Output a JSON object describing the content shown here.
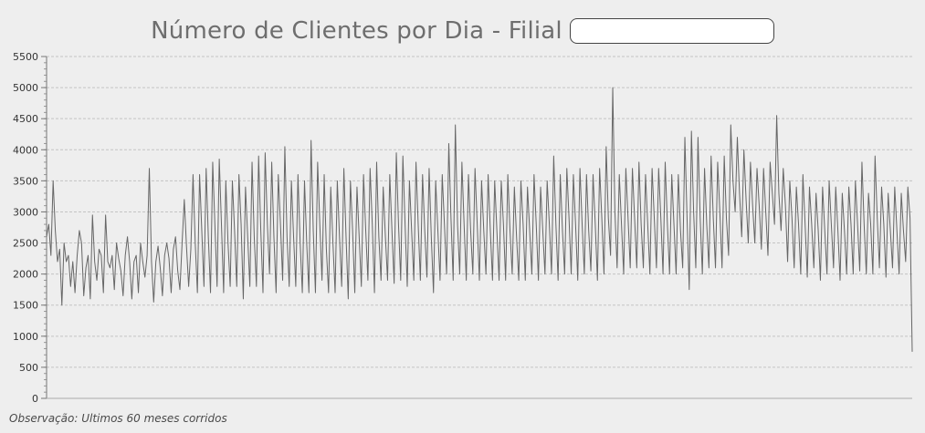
{
  "chart_data": {
    "type": "line",
    "title": "Número de Clientes por Dia - Filial",
    "filial_value": "",
    "xlabel": "",
    "ylabel": "",
    "ylim": [
      0,
      5500
    ],
    "yticks": [
      0,
      500,
      1000,
      1500,
      2000,
      2500,
      3000,
      3500,
      4000,
      4500,
      5000,
      5500
    ],
    "grid": true,
    "series": [
      {
        "line_color": "#666666",
        "values": [
          2600,
          2800,
          2300,
          3500,
          2700,
          2200,
          2400,
          1500,
          2500,
          2200,
          2300,
          1800,
          2200,
          1700,
          2300,
          2700,
          2500,
          1650,
          2100,
          2300,
          1600,
          2950,
          2200,
          1900,
          2400,
          2300,
          1700,
          2950,
          2200,
          2100,
          2300,
          1750,
          2500,
          2250,
          2050,
          1650,
          2300,
          2600,
          2200,
          1600,
          2200,
          2300,
          1700,
          2500,
          2200,
          1950,
          2300,
          3700,
          2200,
          1550,
          2200,
          2450,
          2100,
          1650,
          2300,
          2500,
          2250,
          1700,
          2400,
          2600,
          2050,
          1750,
          2500,
          3200,
          2450,
          1800,
          2400,
          3600,
          2500,
          1700,
          3600,
          2700,
          1800,
          3700,
          2600,
          1700,
          3800,
          2800,
          1800,
          3850,
          2800,
          1700,
          3500,
          2500,
          1800,
          3500,
          2700,
          1800,
          3600,
          2800,
          1600,
          3400,
          2600,
          1800,
          3800,
          2600,
          1800,
          3900,
          2700,
          1700,
          3950,
          2800,
          2000,
          3800,
          2600,
          1700,
          3600,
          2800,
          1900,
          4050,
          2600,
          1800,
          3500,
          2600,
          1800,
          3600,
          2500,
          1700,
          3500,
          2500,
          1700,
          4150,
          2700,
          1700,
          3800,
          2800,
          1900,
          3600,
          2400,
          1700,
          3400,
          2500,
          1700,
          3500,
          2600,
          1800,
          3700,
          2600,
          1600,
          3500,
          2700,
          1700,
          3400,
          2600,
          1800,
          3600,
          2700,
          1900,
          3700,
          2800,
          1700,
          3800,
          2600,
          1900,
          3400,
          2600,
          1900,
          3600,
          2700,
          1850,
          3950,
          2800,
          1900,
          3900,
          2800,
          1800,
          3500,
          2700,
          1900,
          3800,
          2800,
          1900,
          3600,
          2700,
          1950,
          3700,
          2600,
          1700,
          3500,
          2700,
          1900,
          3600,
          2800,
          2000,
          4100,
          2900,
          1900,
          4400,
          2800,
          2000,
          3800,
          2800,
          1900,
          3600,
          2700,
          2000,
          3700,
          2800,
          1900,
          3500,
          2700,
          2000,
          3600,
          2700,
          1900,
          3500,
          2700,
          1900,
          3500,
          2800,
          1900,
          3600,
          2700,
          2000,
          3400,
          2600,
          1900,
          3500,
          2800,
          1900,
          3400,
          2700,
          2000,
          3600,
          2800,
          1900,
          3400,
          2700,
          2000,
          3500,
          2800,
          2000,
          3900,
          2800,
          1900,
          3600,
          2700,
          2000,
          3700,
          2900,
          2000,
          3600,
          2800,
          1900,
          3700,
          2800,
          2000,
          3600,
          2700,
          2050,
          3600,
          2800,
          1900,
          3700,
          2900,
          2000,
          4050,
          2900,
          2300,
          5000,
          3000,
          2100,
          3600,
          2800,
          2000,
          3700,
          2900,
          2100,
          3700,
          2900,
          2100,
          3800,
          2800,
          2100,
          3600,
          2800,
          2000,
          3700,
          2900,
          2100,
          3700,
          2900,
          2000,
          3800,
          2800,
          2000,
          3600,
          2800,
          2000,
          3600,
          2700,
          2100,
          4200,
          2900,
          1750,
          4300,
          3000,
          2100,
          4200,
          2900,
          2000,
          3700,
          2800,
          2100,
          3900,
          2900,
          2100,
          3800,
          3000,
          2100,
          3900,
          2900,
          2300,
          4400,
          3500,
          3000,
          4200,
          3300,
          2600,
          4000,
          3200,
          2500,
          3800,
          3100,
          2500,
          3700,
          3100,
          2400,
          3700,
          3000,
          2300,
          3800,
          3300,
          2800,
          4550,
          3300,
          2700,
          3700,
          3100,
          2200,
          3500,
          2900,
          2100,
          3400,
          2800,
          2000,
          3600,
          2800,
          1950,
          3400,
          2800,
          2100,
          3300,
          2700,
          1900,
          3400,
          2700,
          2000,
          3500,
          2800,
          2100,
          3400,
          2700,
          1900,
          3300,
          2700,
          2000,
          3400,
          2800,
          2000,
          3500,
          2800,
          2050,
          3800,
          2800,
          2000,
          3300,
          2800,
          2000,
          3900,
          2900,
          2100,
          3400,
          2800,
          1950,
          3300,
          2700,
          2100,
          3400,
          2700,
          2000,
          3300,
          2700,
          2200,
          3400,
          2900,
          750
        ]
      }
    ]
  },
  "note": "Observação: Ultimos 60 meses corridos"
}
